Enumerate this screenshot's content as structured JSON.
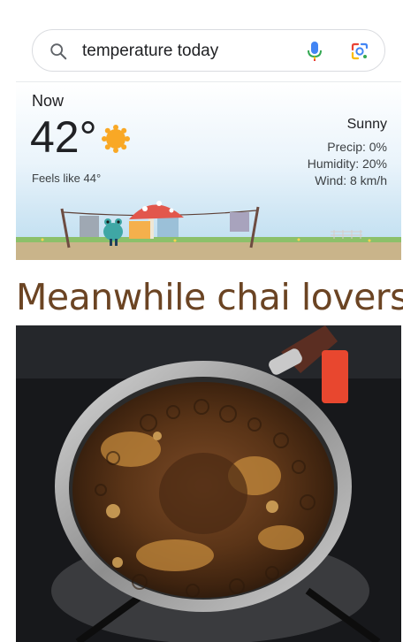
{
  "search": {
    "query": "temperature today",
    "icons": [
      "search-icon",
      "mic-icon",
      "lens-icon"
    ]
  },
  "weather": {
    "now_label": "Now",
    "temperature": "42°",
    "feels_like": "Feels like 44°",
    "condition": "Sunny",
    "precip": "Precip: 0%",
    "humidity": "Humidity: 20%",
    "wind": "Wind: 8 km/h",
    "condition_icon": "sun-icon"
  },
  "post": {
    "headline": "Meanwhile chai lovers:"
  },
  "colors": {
    "headline": "#6b4423",
    "sun": "#f9a825",
    "mic_blue": "#4285f4",
    "mic_red": "#ea4335"
  }
}
